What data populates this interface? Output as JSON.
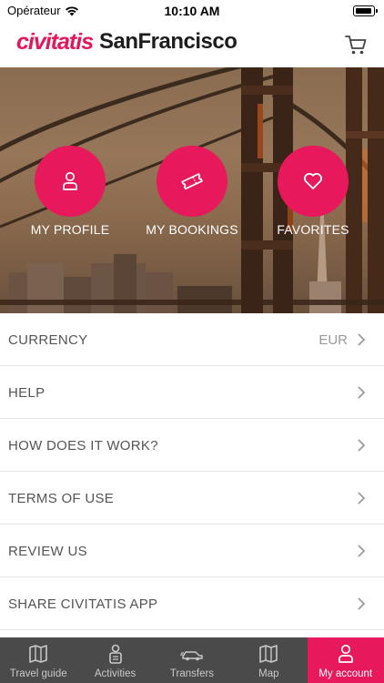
{
  "status_bar": {
    "carrier": "Opérateur",
    "time": "10:10 AM",
    "icons": [
      "wifi-icon",
      "battery-icon"
    ]
  },
  "header": {
    "brand": "civitatis",
    "city": "SanFrancisco",
    "icons": [
      "cart-icon"
    ]
  },
  "hero": {
    "actions": [
      {
        "label": "MY PROFILE",
        "icon": "user-icon"
      },
      {
        "label": "MY BOOKINGS",
        "icon": "ticket-icon"
      },
      {
        "label": "FAVORITES",
        "icon": "heart-icon"
      }
    ]
  },
  "menu": {
    "items": [
      {
        "label": "CURRENCY",
        "value": "EUR"
      },
      {
        "label": "HELP"
      },
      {
        "label": "HOW DOES IT WORK?"
      },
      {
        "label": "TERMS OF USE"
      },
      {
        "label": "REVIEW US"
      },
      {
        "label": "SHARE CIVITATIS APP"
      }
    ]
  },
  "tabs": [
    {
      "label": "Travel guide",
      "icon": "map-book-icon",
      "active": false
    },
    {
      "label": "Activities",
      "icon": "person-icon",
      "active": false
    },
    {
      "label": "Transfers",
      "icon": "car-icon",
      "active": false
    },
    {
      "label": "Map",
      "icon": "map-icon",
      "active": false
    },
    {
      "label": "My account",
      "icon": "user-icon",
      "active": true
    }
  ],
  "colors": {
    "accent": "#e8185c",
    "tab_bar": "#4a4a4a",
    "brand_text": "#e5175b"
  }
}
